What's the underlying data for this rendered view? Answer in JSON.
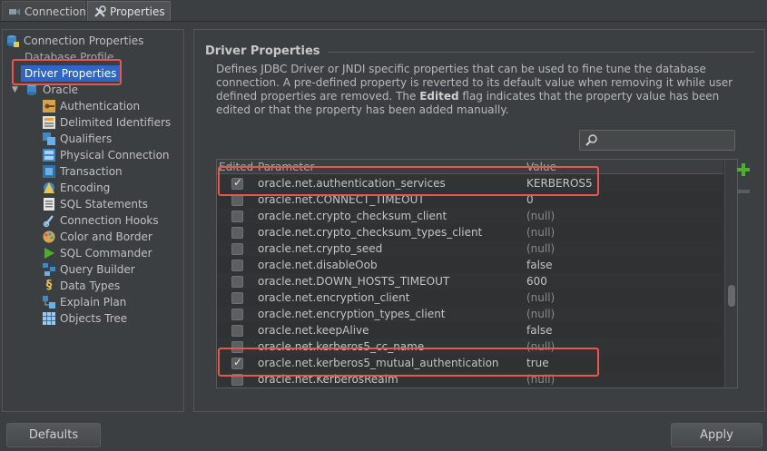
{
  "tabs": [
    {
      "label": "Connection",
      "icon": "connection-icon"
    },
    {
      "label": "Properties",
      "icon": "tools-icon"
    }
  ],
  "tree": {
    "items": [
      {
        "label": "Connection Properties",
        "icon": "database-icon"
      },
      {
        "label": "Database Profile"
      },
      {
        "label": "Driver Properties"
      },
      {
        "label": "Oracle",
        "icon": "oracle-db-icon"
      },
      {
        "label": "Authentication",
        "icon": "key-icon"
      },
      {
        "label": "Delimited Identifiers",
        "icon": "delimited-icon"
      },
      {
        "label": "Qualifiers",
        "icon": "qualifiers-icon"
      },
      {
        "label": "Physical Connection",
        "icon": "physical-connection-icon"
      },
      {
        "label": "Transaction",
        "icon": "transaction-icon"
      },
      {
        "label": "Encoding",
        "icon": "encoding-icon"
      },
      {
        "label": "SQL Statements",
        "icon": "sql-statements-icon"
      },
      {
        "label": "Connection Hooks",
        "icon": "hook-icon"
      },
      {
        "label": "Color and Border",
        "icon": "palette-icon"
      },
      {
        "label": "SQL Commander",
        "icon": "play-icon"
      },
      {
        "label": "Query Builder",
        "icon": "query-builder-icon"
      },
      {
        "label": "Data Types",
        "icon": "dollar-icon"
      },
      {
        "label": "Explain Plan",
        "icon": "explain-plan-icon"
      },
      {
        "label": "Objects Tree",
        "icon": "grid-icon"
      }
    ]
  },
  "panel": {
    "title": "Driver Properties",
    "description_1": "Defines JDBC Driver or JNDI specific properties that can be used to fine tune the database connection. A pre-defined property is reverted to its default value when removing it while user defined properties are removed. The ",
    "description_bold": "Edited",
    "description_2": " flag indicates that the property value has been edited or that the property has been added manually."
  },
  "table": {
    "columns": [
      "Edited",
      "Parameter",
      "Value"
    ],
    "rows": [
      {
        "edited": true,
        "parameter": "oracle.net.authentication_services",
        "value": "KERBEROS5"
      },
      {
        "edited": false,
        "parameter": "oracle.net.CONNECT_TIMEOUT",
        "value": "0"
      },
      {
        "edited": false,
        "parameter": "oracle.net.crypto_checksum_client",
        "value": "(null)"
      },
      {
        "edited": false,
        "parameter": "oracle.net.crypto_checksum_types_client",
        "value": "(null)"
      },
      {
        "edited": false,
        "parameter": "oracle.net.crypto_seed",
        "value": "(null)"
      },
      {
        "edited": false,
        "parameter": "oracle.net.disableOob",
        "value": "false"
      },
      {
        "edited": false,
        "parameter": "oracle.net.DOWN_HOSTS_TIMEOUT",
        "value": "600"
      },
      {
        "edited": false,
        "parameter": "oracle.net.encryption_client",
        "value": "(null)"
      },
      {
        "edited": false,
        "parameter": "oracle.net.encryption_types_client",
        "value": "(null)"
      },
      {
        "edited": false,
        "parameter": "oracle.net.keepAlive",
        "value": "false"
      },
      {
        "edited": false,
        "parameter": "oracle.net.kerberos5_cc_name",
        "value": "(null)"
      },
      {
        "edited": true,
        "parameter": "oracle.net.kerberos5_mutual_authentication",
        "value": "true"
      },
      {
        "edited": false,
        "parameter": "oracle.net.KerberosRealm",
        "value": "(null)"
      }
    ]
  },
  "buttons": {
    "defaults": "Defaults",
    "apply": "Apply"
  },
  "colors": {
    "selection": "#2f65ca",
    "highlight": "#e8574e",
    "add": "#4caf2a"
  }
}
